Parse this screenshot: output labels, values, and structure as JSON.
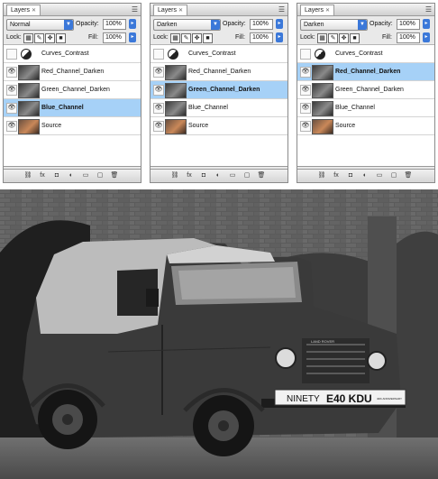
{
  "panels": [
    {
      "tab": "Layers",
      "blend_mode": "Normal",
      "opacity_label": "Opacity:",
      "opacity": "100%",
      "lock_label": "Lock:",
      "fill_label": "Fill:",
      "fill": "100%",
      "layers": [
        {
          "name": "Curves_Contrast",
          "type": "adjustment",
          "visible": false,
          "selected": false
        },
        {
          "name": "Red_Channel_Darken",
          "type": "gray",
          "visible": true,
          "selected": false
        },
        {
          "name": "Green_Channel_Darken",
          "type": "gray",
          "visible": true,
          "selected": false
        },
        {
          "name": "Blue_Channel",
          "type": "gray",
          "visible": true,
          "selected": true
        },
        {
          "name": "Source",
          "type": "color",
          "visible": true,
          "selected": false
        }
      ]
    },
    {
      "tab": "Layers",
      "blend_mode": "Darken",
      "opacity_label": "Opacity:",
      "opacity": "100%",
      "lock_label": "Lock:",
      "fill_label": "Fill:",
      "fill": "100%",
      "layers": [
        {
          "name": "Curves_Contrast",
          "type": "adjustment",
          "visible": false,
          "selected": false
        },
        {
          "name": "Red_Channel_Darken",
          "type": "gray",
          "visible": true,
          "selected": false
        },
        {
          "name": "Green_Channel_Darken",
          "type": "gray",
          "visible": true,
          "selected": true
        },
        {
          "name": "Blue_Channel",
          "type": "gray",
          "visible": true,
          "selected": false
        },
        {
          "name": "Source",
          "type": "color",
          "visible": true,
          "selected": false
        }
      ]
    },
    {
      "tab": "Layers",
      "blend_mode": "Darken",
      "opacity_label": "Opacity:",
      "opacity": "100%",
      "lock_label": "Lock:",
      "fill_label": "Fill:",
      "fill": "100%",
      "layers": [
        {
          "name": "Curves_Contrast",
          "type": "adjustment",
          "visible": false,
          "selected": false
        },
        {
          "name": "Red_Channel_Darken",
          "type": "gray",
          "visible": true,
          "selected": true
        },
        {
          "name": "Green_Channel_Darken",
          "type": "gray",
          "visible": true,
          "selected": false
        },
        {
          "name": "Blue_Channel",
          "type": "gray",
          "visible": true,
          "selected": false
        },
        {
          "name": "Source",
          "type": "color",
          "visible": true,
          "selected": false
        }
      ]
    }
  ],
  "photo": {
    "plate_left": "NINETY",
    "plate_number": "E40 KDU",
    "plate_small": "40th ANNIVERSARY",
    "badge": "LAND ROVER"
  },
  "colors": {
    "selected_row": "#a6d1f7",
    "arrow_blue": "#3b78d9"
  }
}
